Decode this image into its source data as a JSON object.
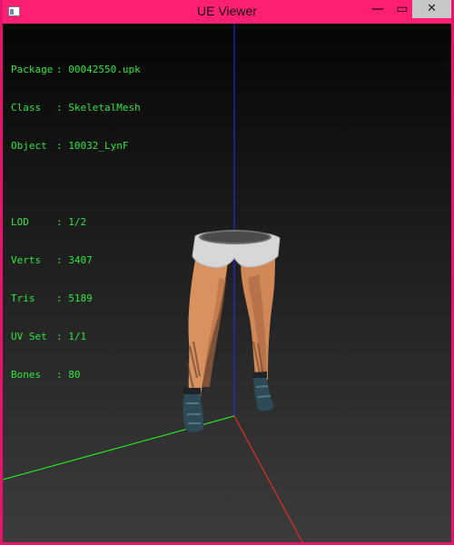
{
  "window": {
    "title": "UE Viewer",
    "minimize_glyph": "—",
    "maximize_glyph": "▭",
    "close_glyph": "✕",
    "accent_color": "#ff1f73"
  },
  "info": {
    "rows": [
      {
        "key": "Package",
        "sep": ": ",
        "value": "00042550.upk"
      },
      {
        "key": "Class",
        "sep": ": ",
        "value": "SkeletalMesh"
      },
      {
        "key": "Object",
        "sep": ": ",
        "value": "10032_LynF"
      }
    ],
    "stats": [
      {
        "key": "LOD",
        "sep": ": ",
        "value": "1/2"
      },
      {
        "key": "Verts",
        "sep": ": ",
        "value": "3407"
      },
      {
        "key": "Tris",
        "sep": ": ",
        "value": "5189"
      },
      {
        "key": "UV Set",
        "sep": ": ",
        "value": "1/1"
      },
      {
        "key": "Bones",
        "sep": ": ",
        "value": "80"
      }
    ],
    "text_color": "#2fe43f"
  },
  "axes": {
    "x_color": "#ff2a2a",
    "y_color": "#22ff22",
    "z_color": "#2a2aff"
  }
}
